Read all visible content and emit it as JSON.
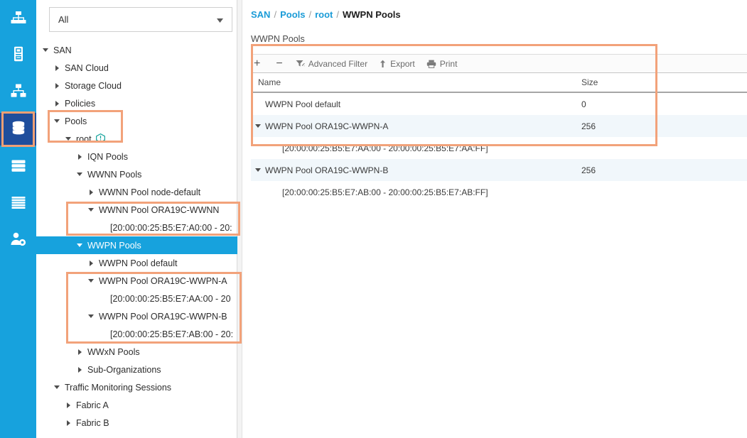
{
  "colors": {
    "rail_bg": "#17a2dd",
    "rail_active_bg": "#1f4e9c",
    "highlight_orange": "#f2a27a",
    "selection_blue": "#17a2dd",
    "link_blue": "#1a9bd7",
    "row_alt": "#f1f7fb",
    "info_badge_teal": "#12a19a"
  },
  "rail": {
    "items": [
      {
        "icon": "equipment-icon",
        "active": false
      },
      {
        "icon": "servers-icon",
        "active": false
      },
      {
        "icon": "lan-icon",
        "active": false
      },
      {
        "icon": "san-icon",
        "active": true
      },
      {
        "icon": "storage-icon",
        "active": false
      },
      {
        "icon": "chassis-icon",
        "active": false
      },
      {
        "icon": "admin-icon",
        "active": false
      }
    ]
  },
  "filter": {
    "selected": "All",
    "caret": "chevron-down-icon"
  },
  "tree": {
    "nodes": [
      {
        "label": "SAN",
        "indent": 0,
        "state": "expanded"
      },
      {
        "label": "SAN Cloud",
        "indent": 1,
        "state": "collapsed"
      },
      {
        "label": "Storage Cloud",
        "indent": 1,
        "state": "collapsed"
      },
      {
        "label": "Policies",
        "indent": 1,
        "state": "collapsed"
      },
      {
        "label": "Pools",
        "indent": 1,
        "state": "expanded"
      },
      {
        "label": "root",
        "indent": 2,
        "state": "expanded",
        "badge": "info-icon"
      },
      {
        "label": "IQN Pools",
        "indent": 3,
        "state": "collapsed"
      },
      {
        "label": "WWNN Pools",
        "indent": 3,
        "state": "expanded"
      },
      {
        "label": "WWNN Pool node-default",
        "indent": 4,
        "state": "collapsed"
      },
      {
        "label": "WWNN Pool ORA19C-WWNN",
        "indent": 4,
        "state": "expanded"
      },
      {
        "label": "[20:00:00:25:B5:E7:A0:00 - 20:",
        "indent": 5,
        "state": "leaf"
      },
      {
        "label": "WWPN Pools",
        "indent": 3,
        "state": "expanded",
        "selected": true
      },
      {
        "label": "WWPN Pool default",
        "indent": 4,
        "state": "collapsed"
      },
      {
        "label": "WWPN Pool ORA19C-WWPN-A",
        "indent": 4,
        "state": "expanded"
      },
      {
        "label": "[20:00:00:25:B5:E7:AA:00 - 20",
        "indent": 5,
        "state": "leaf"
      },
      {
        "label": "WWPN Pool ORA19C-WWPN-B",
        "indent": 4,
        "state": "expanded"
      },
      {
        "label": "[20:00:00:25:B5:E7:AB:00 - 20:",
        "indent": 5,
        "state": "leaf"
      },
      {
        "label": "WWxN Pools",
        "indent": 3,
        "state": "collapsed"
      },
      {
        "label": "Sub-Organizations",
        "indent": 3,
        "state": "collapsed"
      },
      {
        "label": "Traffic Monitoring Sessions",
        "indent": 1,
        "state": "expanded"
      },
      {
        "label": "Fabric A",
        "indent": 2,
        "state": "collapsed"
      },
      {
        "label": "Fabric B",
        "indent": 2,
        "state": "collapsed"
      }
    ]
  },
  "breadcrumb": {
    "parts": [
      {
        "text": "SAN",
        "current": false
      },
      {
        "text": "Pools",
        "current": false
      },
      {
        "text": "root",
        "current": false
      },
      {
        "text": "WWPN Pools",
        "current": true
      }
    ],
    "separator": "/"
  },
  "page": {
    "title": "WWPN Pools"
  },
  "toolbar": {
    "buttons": [
      {
        "label": "+",
        "icon": "plus-icon",
        "plain": true
      },
      {
        "label": "−",
        "icon": "minus-icon",
        "plain": true
      },
      {
        "label": "Advanced Filter",
        "icon": "filter-icon",
        "plain": false
      },
      {
        "label": "Export",
        "icon": "export-upload-icon",
        "plain": false
      },
      {
        "label": "Print",
        "icon": "printer-icon",
        "plain": false
      }
    ]
  },
  "table": {
    "columns": [
      "Name",
      "Size"
    ],
    "rows": [
      {
        "name": "WWPN Pool default",
        "size": "0",
        "indent": 1,
        "twist": "none",
        "alt": false
      },
      {
        "name": "WWPN Pool ORA19C-WWPN-A",
        "size": "256",
        "indent": 0,
        "twist": "expanded",
        "alt": true
      },
      {
        "name": "[20:00:00:25:B5:E7:AA:00 - 20:00:00:25:B5:E7:AA:FF]",
        "size": "",
        "indent": 2,
        "twist": "none",
        "alt": false
      },
      {
        "name": "WWPN Pool ORA19C-WWPN-B",
        "size": "256",
        "indent": 0,
        "twist": "expanded",
        "alt": true
      },
      {
        "name": "[20:00:00:25:B5:E7:AB:00 - 20:00:00:25:B5:E7:AB:FF]",
        "size": "",
        "indent": 2,
        "twist": "none",
        "alt": false
      }
    ]
  },
  "annotations": {
    "boxes": [
      {
        "target": "sidebar-san-icon"
      },
      {
        "target": "tree-pools-root"
      },
      {
        "target": "tree-wwnn-pool-ora19c"
      },
      {
        "target": "tree-wwpn-pools-ora19c"
      },
      {
        "target": "table-wwpn-pool-rows"
      }
    ]
  }
}
